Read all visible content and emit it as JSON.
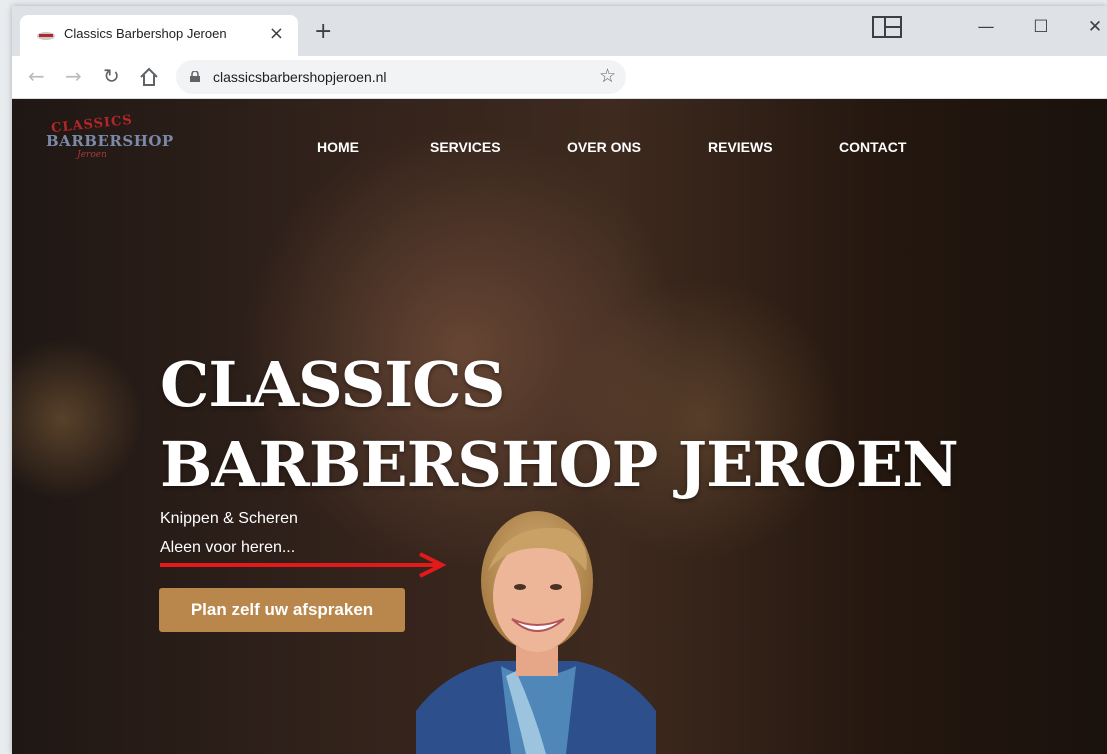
{
  "browser": {
    "tab_title": "Classics Barbershop Jeroen",
    "tab_close": "×",
    "new_tab": "+",
    "url": "classicsbarbershopjeroen.nl",
    "window_controls": {
      "minimize": "—",
      "maximize": "☐",
      "close": "✕"
    }
  },
  "site": {
    "logo": {
      "top": "CLASSICS",
      "middle": "BARBERSHOP",
      "bottom": "Jeroen"
    },
    "nav": [
      "HOME",
      "SERVICES",
      "OVER ONS",
      "REVIEWS",
      "CONTACT"
    ],
    "hero": {
      "line1": "CLASSICS",
      "line2": "BARBERSHOP JEROEN",
      "sub1": "Knippen & Scheren",
      "sub2": "Aleen voor heren...",
      "cta": "Plan zelf uw afspraken"
    }
  },
  "colors": {
    "accent": "#b9874b",
    "arrow": "#e41a1a",
    "logo_red": "#b4262a"
  }
}
